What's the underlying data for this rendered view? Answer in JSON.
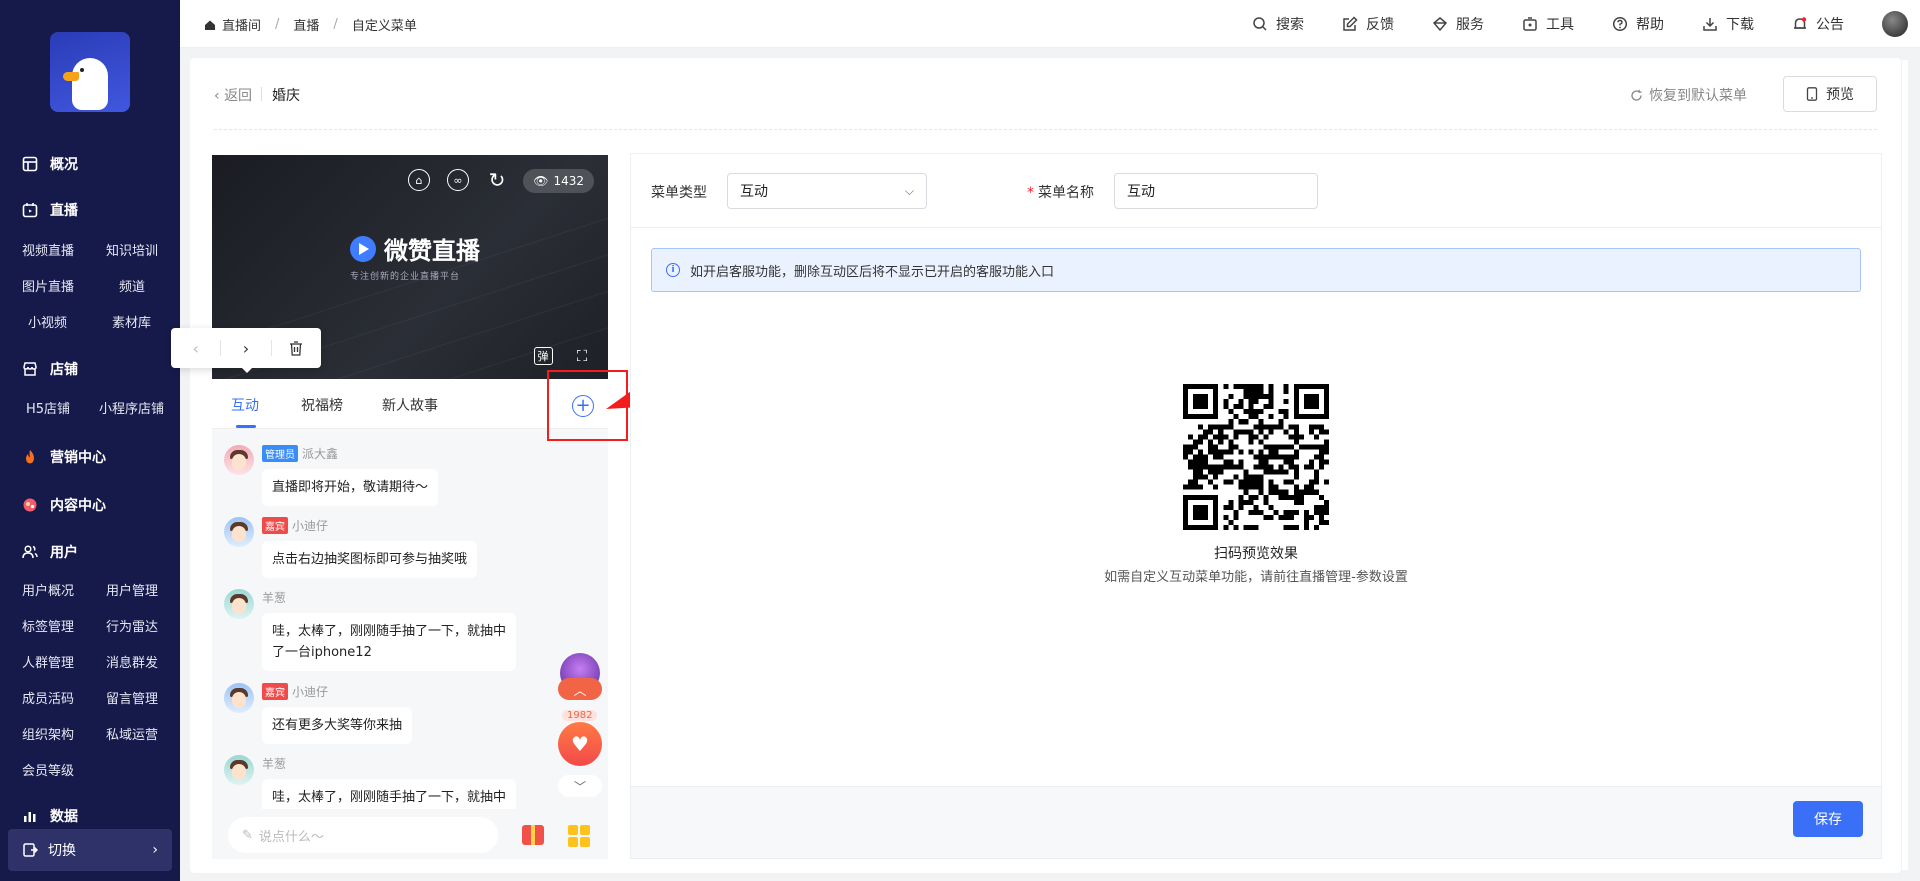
{
  "sidebar": {
    "sections": [
      {
        "label": "概况",
        "icon": "dashboard-icon"
      },
      {
        "label": "直播",
        "icon": "live-icon",
        "items": [
          "视频直播",
          "知识培训",
          "图片直播",
          "频道",
          "小视频",
          "素材库"
        ]
      },
      {
        "label": "店铺",
        "icon": "store-icon",
        "items": [
          "H5店铺",
          "小程序店铺"
        ]
      },
      {
        "label": "营销中心",
        "icon": "fire-icon"
      },
      {
        "label": "内容中心",
        "icon": "content-icon"
      },
      {
        "label": "用户",
        "icon": "users-icon",
        "items": [
          "用户概况",
          "用户管理",
          "标签管理",
          "行为雷达",
          "人群管理",
          "消息群发",
          "成员活码",
          "留言管理",
          "组织架构",
          "私域运营",
          "会员等级"
        ]
      },
      {
        "label": "数据",
        "icon": "chart-icon"
      }
    ],
    "switch_label": "切换"
  },
  "breadcrumb": [
    "直播间",
    "直播",
    "自定义菜单"
  ],
  "toolbar": [
    {
      "label": "搜索",
      "icon": "search-icon"
    },
    {
      "label": "反馈",
      "icon": "feedback-icon"
    },
    {
      "label": "服务",
      "icon": "service-icon"
    },
    {
      "label": "工具",
      "icon": "tool-icon"
    },
    {
      "label": "帮助",
      "icon": "help-icon"
    },
    {
      "label": "下载",
      "icon": "download-icon"
    },
    {
      "label": "公告",
      "icon": "bell-icon"
    }
  ],
  "header": {
    "back_label": "返回",
    "title": "婚庆",
    "restore_label": "恢复到默认菜单",
    "preview_label": "预览"
  },
  "phone": {
    "brand": "微赞直播",
    "slogan": "专注创新的企业直播平台",
    "view_count": "1432",
    "danmu_label": "弹",
    "tabs": [
      "互动",
      "祝福榜",
      "新人故事"
    ],
    "messages": [
      {
        "name": "派大鑫",
        "badge": "管理员",
        "badge_type": "admin",
        "avatar": "pink",
        "lines": [
          "直播即将开始，敬请期待～"
        ]
      },
      {
        "name": "小迪仔",
        "badge": "嘉宾",
        "badge_type": "guest",
        "avatar": "blue",
        "lines": [
          "点击右边抽奖图标即可参与抽奖哦"
        ]
      },
      {
        "name": "羊葱",
        "badge": "",
        "badge_type": "",
        "avatar": "green",
        "lines": [
          "哇，太棒了，刚刚随手抽了一下，就抽中",
          "了一台iphone12"
        ]
      },
      {
        "name": "小迪仔",
        "badge": "嘉宾",
        "badge_type": "guest",
        "avatar": "blue",
        "lines": [
          "还有更多大奖等你来抽"
        ]
      },
      {
        "name": "羊葱",
        "badge": "",
        "badge_type": "",
        "avatar": "green",
        "lines": [
          "哇，太棒了，刚刚随手抽了一下，就抽中"
        ]
      }
    ],
    "like_count": "1982",
    "input_placeholder": "说点什么～"
  },
  "form": {
    "type_label": "菜单类型",
    "type_value": "互动",
    "name_label": "菜单名称",
    "name_value": "互动",
    "required_mark": "*"
  },
  "alert": {
    "text": "如开启客服功能，删除互动区后将不显示已开启的客服功能入口"
  },
  "qr": {
    "caption": "扫码预览效果",
    "note": "如需自定义互动菜单功能，请前往直播管理-参数设置"
  },
  "footer": {
    "save_label": "保存"
  },
  "colors": {
    "sidebar_bg": "#161a4a",
    "accent": "#3a6ff7",
    "annotation_red": "#f41d1d"
  }
}
